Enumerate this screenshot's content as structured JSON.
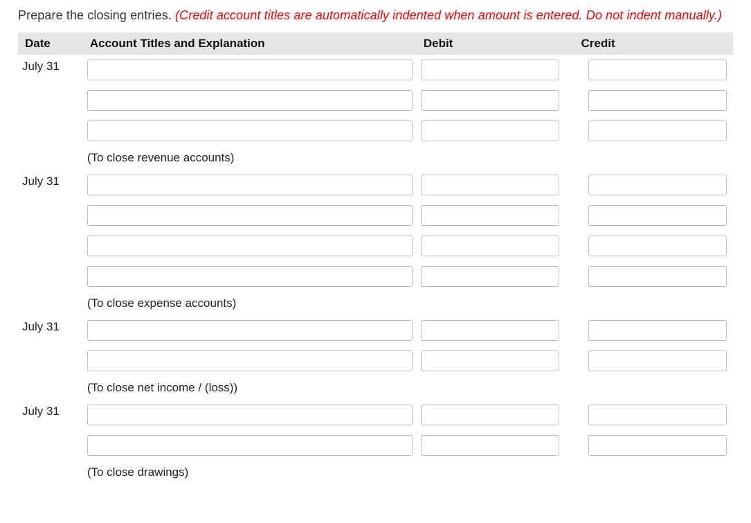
{
  "instruction": {
    "text": "Prepare the closing entries. ",
    "note": "(Credit account titles are automatically indented when amount is entered. Do not indent manually.)"
  },
  "headers": {
    "date": "Date",
    "title": "Account Titles and Explanation",
    "debit": "Debit",
    "credit": "Credit"
  },
  "groups": [
    {
      "date": "July 31",
      "rows": [
        {
          "title": "",
          "debit": "",
          "credit": ""
        },
        {
          "title": "",
          "debit": "",
          "credit": ""
        },
        {
          "title": "",
          "debit": "",
          "credit": ""
        }
      ],
      "explanation": "(To close revenue accounts)"
    },
    {
      "date": "July 31",
      "rows": [
        {
          "title": "",
          "debit": "",
          "credit": ""
        },
        {
          "title": "",
          "debit": "",
          "credit": ""
        },
        {
          "title": "",
          "debit": "",
          "credit": ""
        },
        {
          "title": "",
          "debit": "",
          "credit": ""
        }
      ],
      "explanation": "(To close expense accounts)"
    },
    {
      "date": "July 31",
      "rows": [
        {
          "title": "",
          "debit": "",
          "credit": ""
        },
        {
          "title": "",
          "debit": "",
          "credit": ""
        }
      ],
      "explanation": "(To close net income / (loss))"
    },
    {
      "date": "July 31",
      "rows": [
        {
          "title": "",
          "debit": "",
          "credit": ""
        },
        {
          "title": "",
          "debit": "",
          "credit": ""
        }
      ],
      "explanation": "(To close drawings)"
    }
  ]
}
